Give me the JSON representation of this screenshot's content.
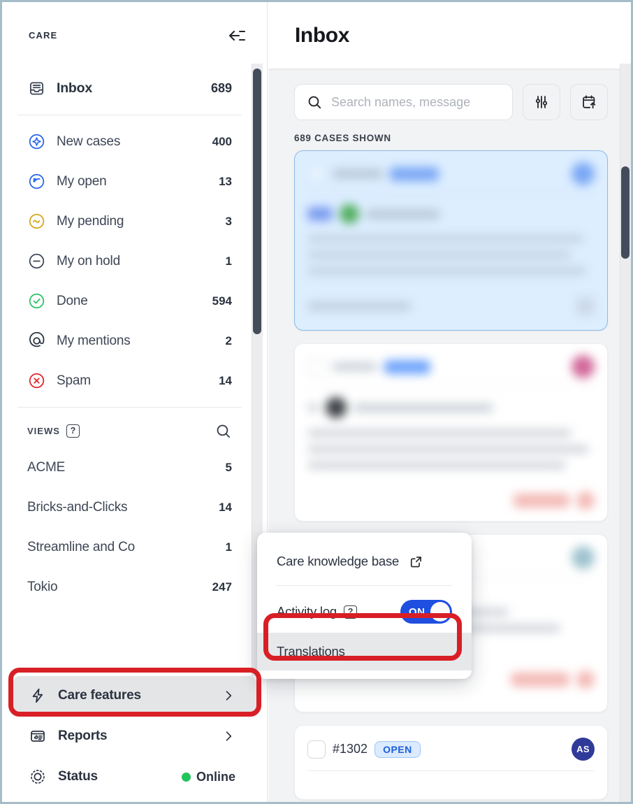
{
  "sidebar": {
    "brand": "CARE",
    "collapse_icon": "collapse-left-icon",
    "primary": {
      "icon": "inbox-icon",
      "label": "Inbox",
      "count": "689"
    },
    "folders": [
      {
        "icon": "sparkle-circle-icon",
        "label": "New cases",
        "count": "400",
        "color": "#2563eb"
      },
      {
        "icon": "reopen-circle-icon",
        "label": "My open",
        "count": "13",
        "color": "#2563eb"
      },
      {
        "icon": "pending-circle-icon",
        "label": "My pending",
        "count": "3",
        "color": "#d8a417"
      },
      {
        "icon": "minus-circle-icon",
        "label": "My on hold",
        "count": "1",
        "color": "#3e4655"
      },
      {
        "icon": "check-circle-icon",
        "label": "Done",
        "count": "594",
        "color": "#28c264"
      },
      {
        "icon": "at-circle-icon",
        "label": "My mentions",
        "count": "2",
        "color": "#2b3340"
      },
      {
        "icon": "x-circle-icon",
        "label": "Spam",
        "count": "14",
        "color": "#e0242b"
      }
    ],
    "views_header": {
      "title": "VIEWS",
      "help_glyph": "?",
      "search_icon": "search-icon"
    },
    "views": [
      {
        "label": "ACME",
        "count": "5"
      },
      {
        "label": "Bricks-and-Clicks",
        "count": "14"
      },
      {
        "label": "Streamline and Co",
        "count": "1"
      },
      {
        "label": "Tokio",
        "count": "247"
      }
    ],
    "bottom": [
      {
        "icon": "bolt-icon",
        "label": "Care features",
        "trailing": "chevron-right-icon",
        "active": true
      },
      {
        "icon": "reports-icon",
        "label": "Reports",
        "trailing": "chevron-right-icon",
        "active": false
      }
    ],
    "status": {
      "icon": "status-dotted-circle-icon",
      "label": "Status",
      "value": "Online",
      "dot_color": "#21c45d"
    }
  },
  "popup": {
    "items": [
      {
        "label": "Care knowledge base",
        "type": "link",
        "trailing_icon": "external-link-icon"
      },
      {
        "label": "Activity log",
        "type": "toggle",
        "help_glyph": "?",
        "toggle_label": "ON",
        "toggle_on": true
      },
      {
        "label": "Translations",
        "type": "plain",
        "shaded": true
      }
    ]
  },
  "main": {
    "title": "Inbox",
    "search": {
      "icon": "search-icon",
      "placeholder": "Search names, message",
      "value": ""
    },
    "toolbar_buttons": [
      {
        "icon": "filter-sliders-icon",
        "name": "filter-button"
      },
      {
        "icon": "calendar-upload-icon",
        "name": "date-export-button"
      }
    ],
    "cases_shown": "689 CASES SHOWN",
    "cards": [
      {
        "id": "",
        "status": "",
        "avatar": "",
        "selected": true,
        "blurred": true
      },
      {
        "id": "",
        "status": "",
        "avatar": "",
        "selected": false,
        "blurred": true
      },
      {
        "id": "",
        "status": "",
        "avatar": "",
        "selected": false,
        "blurred": true
      },
      {
        "id": "#1302",
        "status": "OPEN",
        "avatar": "AS",
        "selected": false,
        "blurred": false
      }
    ]
  },
  "annotations": {
    "highlight_color": "#d81f26",
    "regions": [
      {
        "target": "care-features-row"
      },
      {
        "target": "activity-log-row"
      }
    ]
  },
  "colors": {
    "accent_blue": "#1f4fe0",
    "selected_card_bg": "#ddeeff",
    "page_bg": "#f2f3f5",
    "frame_border": "#a7bcc9"
  }
}
